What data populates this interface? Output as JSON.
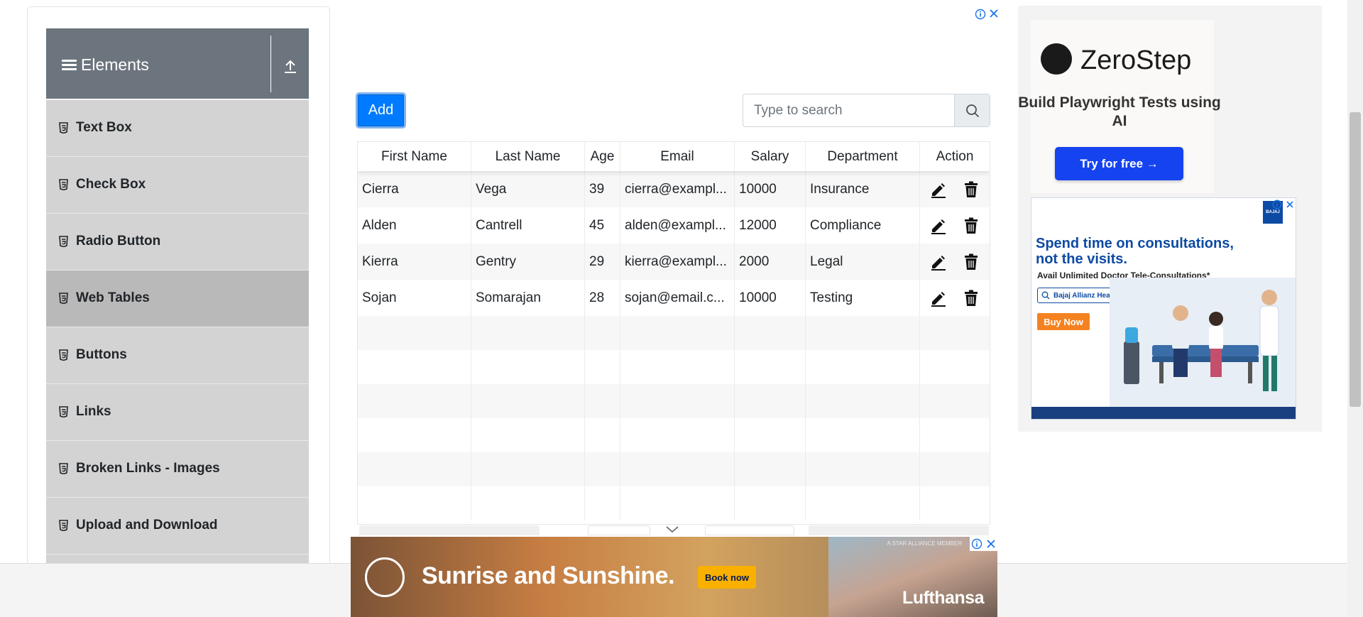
{
  "sidebar": {
    "group_title": "Elements",
    "items": [
      {
        "label": "Text Box",
        "active": false
      },
      {
        "label": "Check Box",
        "active": false
      },
      {
        "label": "Radio Button",
        "active": false
      },
      {
        "label": "Web Tables",
        "active": true
      },
      {
        "label": "Buttons",
        "active": false
      },
      {
        "label": "Links",
        "active": false
      },
      {
        "label": "Broken Links - Images",
        "active": false
      },
      {
        "label": "Upload and Download",
        "active": false
      }
    ]
  },
  "toolbar": {
    "add_label": "Add",
    "search_placeholder": "Type to search"
  },
  "table": {
    "columns": [
      "First Name",
      "Last Name",
      "Age",
      "Email",
      "Salary",
      "Department",
      "Action"
    ],
    "rows": [
      {
        "first": "Cierra",
        "last": "Vega",
        "age": "39",
        "email": "cierra@exampl...",
        "salary": "10000",
        "department": "Insurance"
      },
      {
        "first": "Alden",
        "last": "Cantrell",
        "age": "45",
        "email": "alden@exampl...",
        "salary": "12000",
        "department": "Compliance"
      },
      {
        "first": "Kierra",
        "last": "Gentry",
        "age": "29",
        "email": "kierra@exampl...",
        "salary": "2000",
        "department": "Legal"
      },
      {
        "first": "Sojan",
        "last": "Somarajan",
        "age": "28",
        "email": "sojan@email.c...",
        "salary": "10000",
        "department": "Testing"
      }
    ],
    "empty_rows": 6
  },
  "right_ad": {
    "brand": "ZeroStep",
    "subtitle": "Build Playwright Tests using AI",
    "cta": "Try for free →",
    "second_ad": {
      "logo": "BAJAJ",
      "headline": "Spend time on consultations, not the visits.",
      "subline": "Avail Unlimited Doctor Tele-Consultations*",
      "search_text": "Bajaj Allianz Health Insurance",
      "cta": "Buy Now"
    }
  },
  "bottom_ad": {
    "headline": "Sunrise and Sunshine.",
    "cta": "Book now",
    "brand": "Lufthansa",
    "tagline": "A STAR ALLIANCE MEMBER"
  },
  "colors": {
    "primary": "#007bff",
    "sidebar_header": "#6c757d",
    "sidebar_item": "#d3d3d3",
    "sidebar_item_active": "#b9b9b9",
    "zerostep_button": "#1543f0",
    "bajaj_blue": "#0d4aa3",
    "lufthansa_yellow": "#f9b000"
  },
  "icons": {
    "group": "hamburger-icon",
    "collapse": "upload-arrow-icon",
    "menu_item": "html5-icon",
    "search": "search-icon",
    "edit": "pencil-icon",
    "delete": "trash-icon",
    "ad_info": "info-icon",
    "ad_close": "close-icon"
  }
}
